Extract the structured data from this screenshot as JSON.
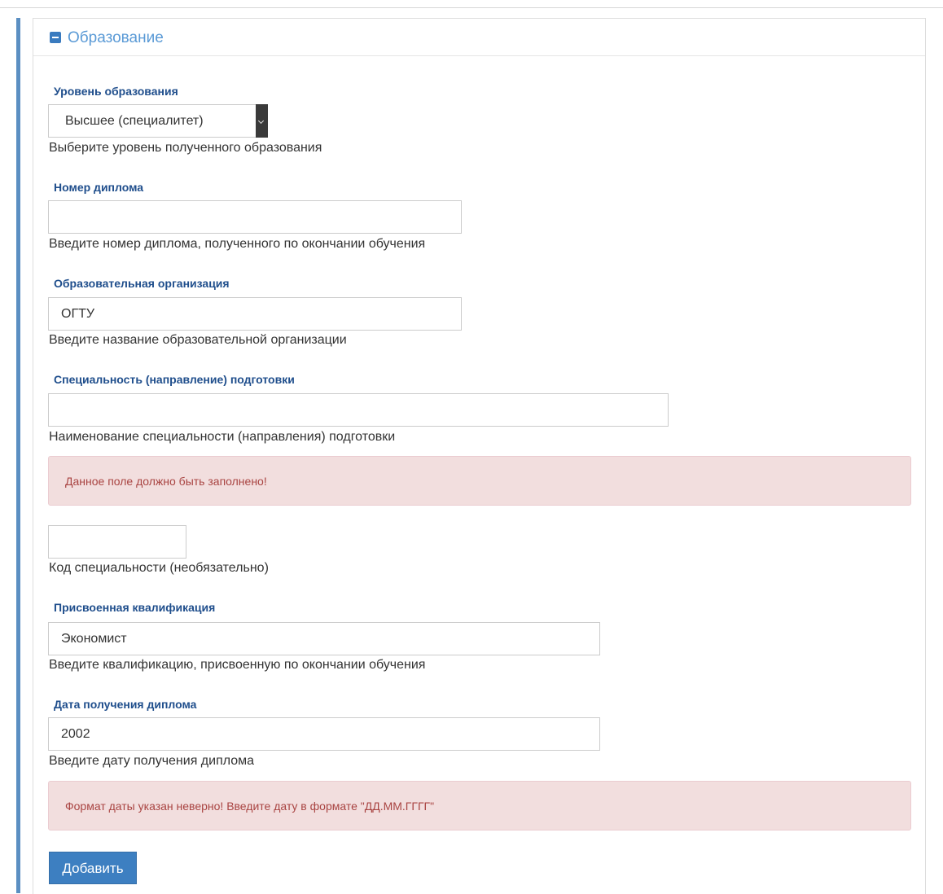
{
  "panel": {
    "title": "Образование"
  },
  "fields": {
    "education_level": {
      "label": "Уровень образования",
      "value": "Высшее (специалитет)",
      "help": "Выберите уровень полученного образования"
    },
    "diploma_number": {
      "label": "Номер диплома",
      "value": "",
      "help": "Введите номер диплома, полученного по окончании обучения"
    },
    "organization": {
      "label": "Образовательная организация",
      "value": "ОГТУ",
      "help": "Введите название образовательной организации"
    },
    "specialty": {
      "label": "Специальность (направление) подготовки",
      "value": "",
      "help": "Наименование специальности (направления) подготовки",
      "error": "Данное поле должно быть заполнено!"
    },
    "specialty_code": {
      "value": "",
      "help": "Код специальности (необязательно)"
    },
    "qualification": {
      "label": "Присвоенная квалификация",
      "value": "Экономист",
      "help": "Введите квалификацию, присвоенную по окончании обучения"
    },
    "diploma_date": {
      "label": "Дата получения диплома",
      "value": "2002",
      "help": "Введите дату получения диплома",
      "error": "Формат даты указан неверно! Введите дату в формате \"ДД.ММ.ГГГГ\""
    }
  },
  "actions": {
    "add_label": "Добавить"
  },
  "colors": {
    "accent": "#3d7fc1",
    "label": "#1f4e8c",
    "error_bg": "#f2dede",
    "error_text": "#a94442"
  }
}
